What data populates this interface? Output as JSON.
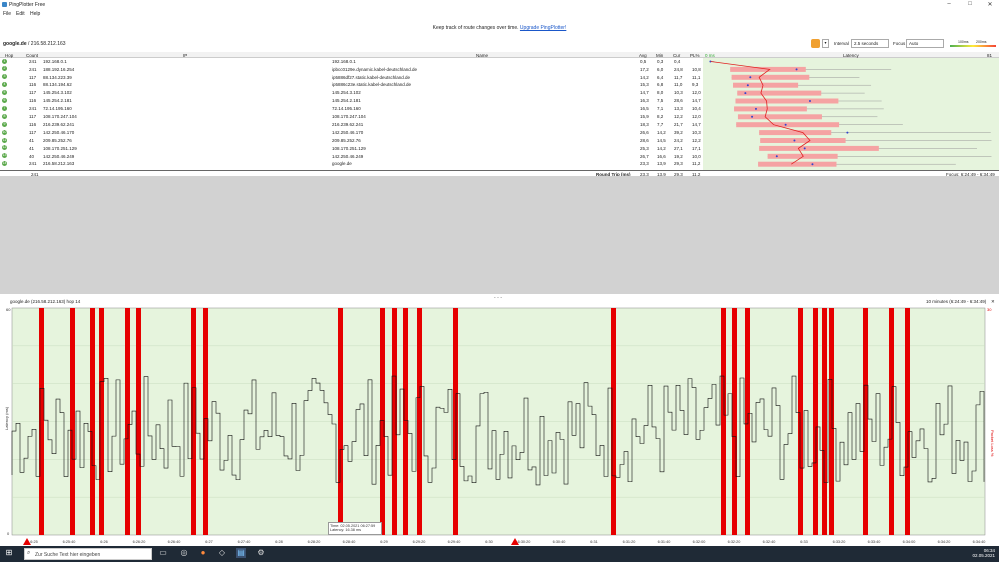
{
  "window": {
    "title": "PingPlotter Free",
    "minimize": "–",
    "maximize": "□",
    "close": "✕"
  },
  "menu": [
    "File",
    "Edit",
    "Help"
  ],
  "banner": {
    "text": "Keep track of route changes over time.",
    "link": "Upgrade PingPlotter!"
  },
  "toolbar": {
    "target_name": "google.de",
    "target_ip": " / 216.58.212.163",
    "interval_label": "Interval",
    "interval_value": "2.5 seconds",
    "focus_label": "Focus",
    "focus_value": "Auto",
    "legend_100": "100ms",
    "legend_200": "200ms"
  },
  "table": {
    "headers": {
      "hop": "Hop",
      "count": "Count",
      "ip": "IP",
      "name": "Name",
      "avg": "Avg",
      "min": "Min",
      "cur": "Cur",
      "pl": "PL%",
      "pl0": "0 ms",
      "latency": "Latency",
      "max": "81 ms"
    },
    "rows": [
      {
        "hop": "1",
        "count": "241",
        "ip": "192.168.0.1",
        "name": "192.168.0.1",
        "avg": "0,5",
        "min": "0,3",
        "cur": "0,4",
        "pl": ""
      },
      {
        "hop": "2",
        "count": "241",
        "ip": "188.192.16.254",
        "name": "ipbcc0129e.dynamic.kabel-deutschland.de",
        "avg": "17,2",
        "min": "6,0",
        "cur": "24,8",
        "pl": "10,8"
      },
      {
        "hop": "3",
        "count": "117",
        "ip": "88.134.223.39",
        "name": "ip5886df27.static.kabel-deutschland.de",
        "avg": "14,2",
        "min": "6,4",
        "cur": "11,7",
        "pl": "11,1"
      },
      {
        "hop": "4",
        "count": "116",
        "ip": "88.134.194.62",
        "name": "ip5886c23e.static.kabel-deutschland.de",
        "avg": "15,3",
        "min": "6,8",
        "cur": "11,0",
        "pl": "9,3"
      },
      {
        "hop": "5",
        "count": "117",
        "ip": "145.254.3.102",
        "name": "145.254.3.102",
        "avg": "14,7",
        "min": "8,0",
        "cur": "10,3",
        "pl": "12,0"
      },
      {
        "hop": "6",
        "count": "116",
        "ip": "145.254.2.181",
        "name": "145.254.2.181",
        "avg": "16,3",
        "min": "7,5",
        "cur": "28,6",
        "pl": "14,7"
      },
      {
        "hop": "7",
        "count": "241",
        "ip": "72.14.195.160",
        "name": "72.14.195.160",
        "avg": "16,5",
        "min": "7,1",
        "cur": "13,3",
        "pl": "10,4"
      },
      {
        "hop": "8",
        "count": "117",
        "ip": "108.170.247.104",
        "name": "108.170.247.104",
        "avg": "15,9",
        "min": "8,2",
        "cur": "12,2",
        "pl": "12,0"
      },
      {
        "hop": "9",
        "count": "116",
        "ip": "216.239.62.241",
        "name": "216.239.62.241",
        "avg": "18,3",
        "min": "7,7",
        "cur": "21,7",
        "pl": "14,7"
      },
      {
        "hop": "10",
        "count": "117",
        "ip": "142.250.46.170",
        "name": "142.250.46.170",
        "avg": "26,6",
        "min": "14,2",
        "cur": "39,2",
        "pl": "10,3"
      },
      {
        "hop": "11",
        "count": "41",
        "ip": "209.85.252.76",
        "name": "209.85.252.76",
        "avg": "28,6",
        "min": "14,5",
        "cur": "24,2",
        "pl": "12,2"
      },
      {
        "hop": "12",
        "count": "41",
        "ip": "108.170.251.129",
        "name": "108.170.251.129",
        "avg": "25,3",
        "min": "14,2",
        "cur": "27,1",
        "pl": "17,1"
      },
      {
        "hop": "13",
        "count": "40",
        "ip": "142.250.46.249",
        "name": "142.250.46.249",
        "avg": "26,7",
        "min": "16,6",
        "cur": "19,2",
        "pl": "10,0"
      },
      {
        "hop": "14",
        "count": "241",
        "ip": "216.58.212.163",
        "name": "google.de",
        "avg": "23,3",
        "min": "13,9",
        "cur": "29,3",
        "pl": "11,2"
      }
    ],
    "round_trip": {
      "count": "241",
      "label": "Round Trip (ms)",
      "avg": "23,3",
      "min": "13,9",
      "cur": "29,3",
      "pl": "11,2",
      "focus": "Focus: 6:24:49 - 6:34:49"
    }
  },
  "graph": {
    "title": "google.de (216.58.212.163) hop 14",
    "range": "10 minutes (6:24:49 - 6:34:49)",
    "drag_handle": "• • •",
    "y_left_label": "Latency (ms)",
    "y_right_label": "Packet Loss %",
    "y_top_left": "60",
    "y_bottom_left": "0",
    "y_top_right": "30",
    "tooltip_time": "Time: 02.05.2021 06:27:59",
    "tooltip_latency": "Latency: 16.38 ms",
    "x_ticks": [
      "6:25",
      "6:25:40",
      "6:26",
      "6:26:20",
      "6:26:40",
      "6:27",
      "6:27:40",
      "6:28",
      "6:28:20",
      "6:28:40",
      "6:29",
      "6:29:20",
      "6:29:40",
      "6:30",
      "6:30:20",
      "6:30:40",
      "6:31",
      "6:31:20",
      "6:31:40",
      "6:32:00",
      "6:32:20",
      "6:32:40",
      "6:33",
      "6:33:20",
      "6:33:40",
      "6:34:00",
      "6:34:20",
      "6:34:40"
    ],
    "loss_color": "#e60000",
    "bg_color": "#e6f4dd"
  },
  "taskbar": {
    "search_placeholder": "Zur Suche Text hier eingeben",
    "time": "06:34",
    "date": "02.05.2021"
  }
}
